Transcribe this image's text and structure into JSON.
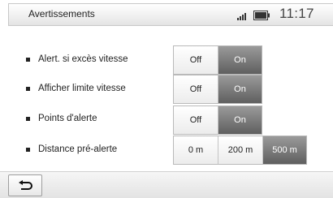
{
  "header": {
    "title": "Avertissements",
    "time": "11:17",
    "status_icons": [
      "signal-strength-icon",
      "battery-icon"
    ]
  },
  "settings": [
    {
      "label": "Alert. si excès vitesse",
      "options": [
        "Off",
        "On"
      ],
      "selected": "On"
    },
    {
      "label": "Afficher limite vitesse",
      "options": [
        "Off",
        "On"
      ],
      "selected": "On"
    },
    {
      "label": "Points d'alerte",
      "options": [
        "Off",
        "On"
      ],
      "selected": "On"
    },
    {
      "label": "Distance pré-alerte",
      "options": [
        "0 m",
        "200 m",
        "500 m"
      ],
      "selected": "500 m"
    }
  ],
  "footer": {
    "back_icon": "back-arrow-icon"
  },
  "colors": {
    "selected_bg": "#7a7a7a",
    "selected_text": "#ffffff",
    "header_bg": "#f0f0f0"
  }
}
